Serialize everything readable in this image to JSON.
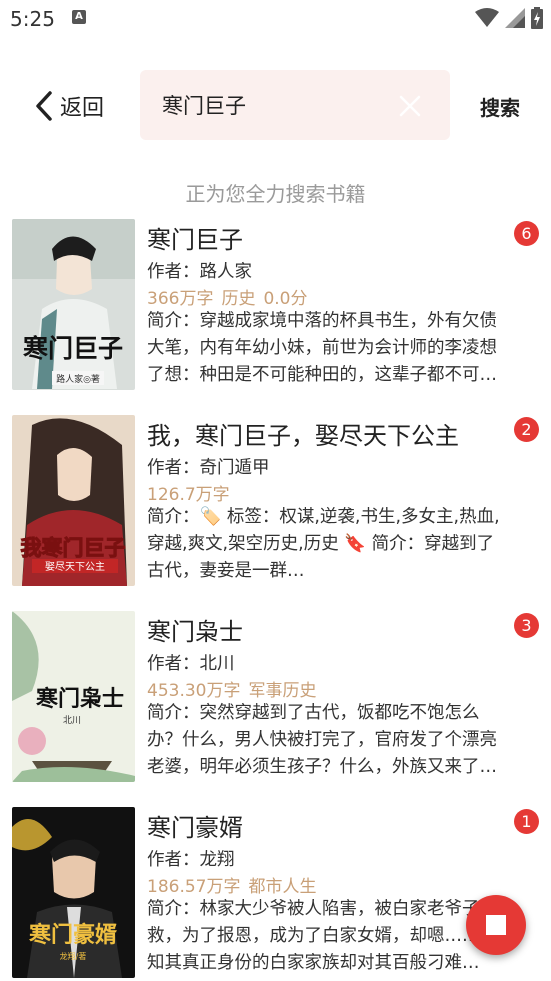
{
  "status_bar": {
    "time": "5:25",
    "notification_icon": "A"
  },
  "header": {
    "back_label": "返回",
    "search_value": "寒门巨子",
    "search_button": "搜索"
  },
  "searching_text": "正为您全力搜索书籍",
  "books": [
    {
      "title": "寒门巨子",
      "author": "作者：路人家",
      "words": "366万字",
      "category": "历史",
      "score": "0.0分",
      "intro": "简介：穿越成家境中落的杯具书生，外有欠债大笔，内有年幼小妹，前世为会计师的李凌想了想：种田是不可能种田的，这辈子都不可能种田的。",
      "badge": "6",
      "cover_text": "寒门巨子",
      "cover_author": "路人家◎著"
    },
    {
      "title": "我，寒门巨子，娶尽天下公主",
      "author": "作者：奇门遁甲",
      "words": "126.7万字",
      "category": "",
      "score": "",
      "intro": "简介：🏷️ 标签：权谋,逆袭,书生,多女主,热血,穿越,爽文,架空历史,历史 🔖 简介：穿越到了古代，妻妾是一群…",
      "badge": "2",
      "cover_text": "我寒门巨子",
      "cover_author": "娶尽天下公主"
    },
    {
      "title": "寒门枭士",
      "author": "作者：北川",
      "words": "453.30万字",
      "category": "军事历史",
      "score": "",
      "intro": "简介：突然穿越到了古代，饭都吃不饱怎么办？什么，男人快被打完了，官府发了个漂亮老婆，明年必须生孩子？什么，外族又来了…",
      "badge": "3",
      "cover_text": "寒门枭士",
      "cover_author": "北川"
    },
    {
      "title": "寒门豪婿",
      "author": "作者：龙翔",
      "words": "186.57万字",
      "category": "都市人生",
      "score": "",
      "intro": "简介：林家大少爷被人陷害，被白家老爷子所救，为了报恩，成为了白家女婿，却嗯……不知其真正身份的白家家族却对其百般刁难…",
      "badge": "1",
      "cover_text": "寒门豪婿",
      "cover_author": "龙翔/著"
    }
  ],
  "colors": {
    "accent": "#e53935",
    "meta": "#c9a078",
    "search_bg": "#fbf0ee"
  }
}
